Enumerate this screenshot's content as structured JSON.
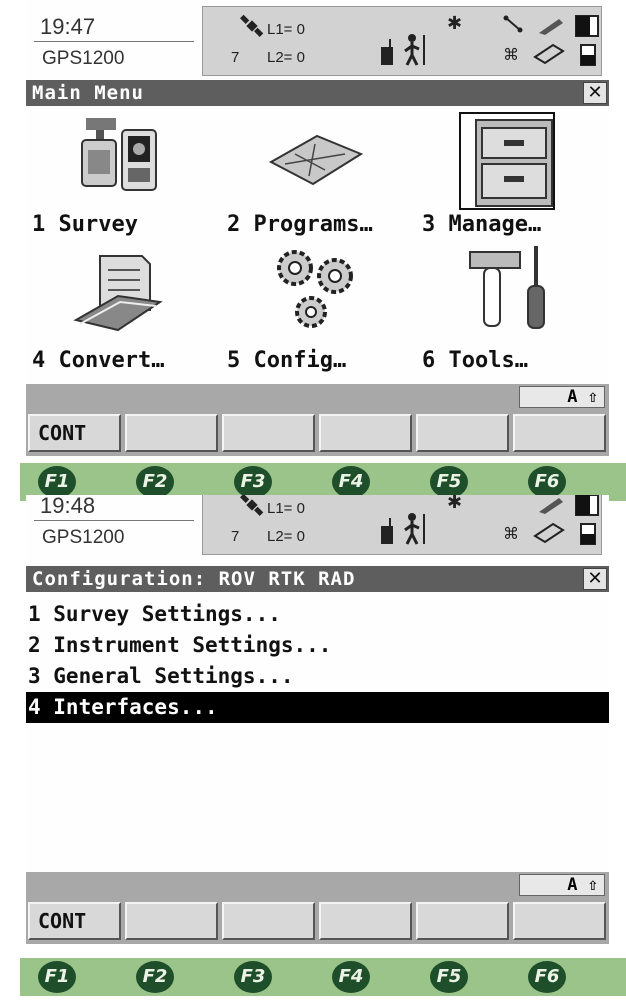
{
  "top_screen": {
    "status": {
      "time": "19:47",
      "model": "GPS1200",
      "sat_count": "7",
      "l1": "L1= 0",
      "l2": "L2= 0"
    },
    "title": "Main Menu",
    "close_label": "✕",
    "menu_items": [
      {
        "label": "1 Survey"
      },
      {
        "label": "2 Programs…"
      },
      {
        "label": "3 Manage…"
      },
      {
        "label": "4 Convert…"
      },
      {
        "label": "5 Config…"
      },
      {
        "label": "6 Tools…"
      }
    ],
    "input_mode": "A ⇧",
    "softkeys": [
      "CONT",
      "",
      "",
      "",
      "",
      ""
    ]
  },
  "function_keys": [
    "F1",
    "F2",
    "F3",
    "F4",
    "F5",
    "F6"
  ],
  "bottom_screen": {
    "status": {
      "time": "19:48",
      "model": "GPS1200",
      "sat_count": "7",
      "l1": "L1= 0",
      "l2": "L2= 0"
    },
    "title": "Configuration: ROV RTK RAD",
    "close_label": "✕",
    "list_items": [
      {
        "label": "1 Survey Settings..."
      },
      {
        "label": "2 Instrument Settings..."
      },
      {
        "label": "3 General Settings..."
      },
      {
        "label": "4 Interfaces..."
      }
    ],
    "selected_index": 3,
    "input_mode": "A ⇧",
    "softkeys": [
      "CONT",
      "",
      "",
      "",
      "",
      ""
    ]
  },
  "icons": {
    "status": [
      "satellite-icon",
      "radio-icon",
      "bluetooth-icon",
      "surveyor-icon",
      "line-icon",
      "pen-icon",
      "battery-icon",
      "memory-card-icon"
    ],
    "menu": [
      "survey-instrument-icon",
      "programs-map-icon",
      "file-cabinet-icon",
      "convert-documents-icon",
      "config-gears-icon",
      "tools-hammer-screwdriver-icon"
    ]
  },
  "colors": {
    "title_bar": "#5e5e5e",
    "softkey_bar": "#a8a8a8",
    "function_bar": "#9ac48a",
    "function_key": "#1f4f2a",
    "selection": "#000000"
  }
}
